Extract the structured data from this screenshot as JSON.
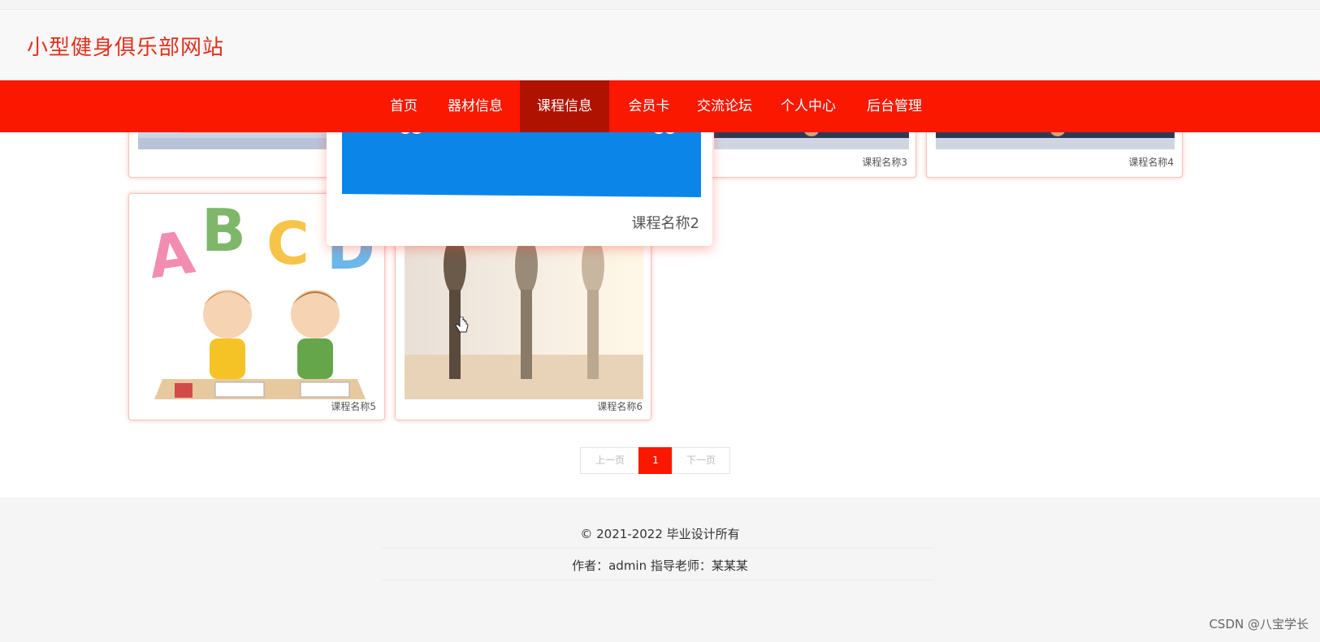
{
  "site": {
    "title": "小型健身俱乐部网站"
  },
  "nav": {
    "items": [
      {
        "label": "首页"
      },
      {
        "label": "器材信息"
      },
      {
        "label": "课程信息",
        "active": true
      },
      {
        "label": "会员卡"
      },
      {
        "label": "交流论坛"
      },
      {
        "label": "个人中心"
      },
      {
        "label": "后台管理"
      }
    ]
  },
  "courses": [
    {
      "caption": ""
    },
    {
      "caption": "课程名称2"
    },
    {
      "caption": "课程名称3"
    },
    {
      "caption": "课程名称4"
    },
    {
      "caption": "课程名称5"
    },
    {
      "caption": "课程名称6"
    }
  ],
  "pagination": {
    "prev": "上一页",
    "current": "1",
    "next": "下一页"
  },
  "footer": {
    "copyright": "© 2021-2022 毕业设计所有",
    "author": "作者：admin 指导老师：某某某"
  },
  "watermark": "CSDN @八宝学长",
  "colors": {
    "brand": "#fa1800",
    "active_nav": "#b01200",
    "title": "#e0301e"
  }
}
